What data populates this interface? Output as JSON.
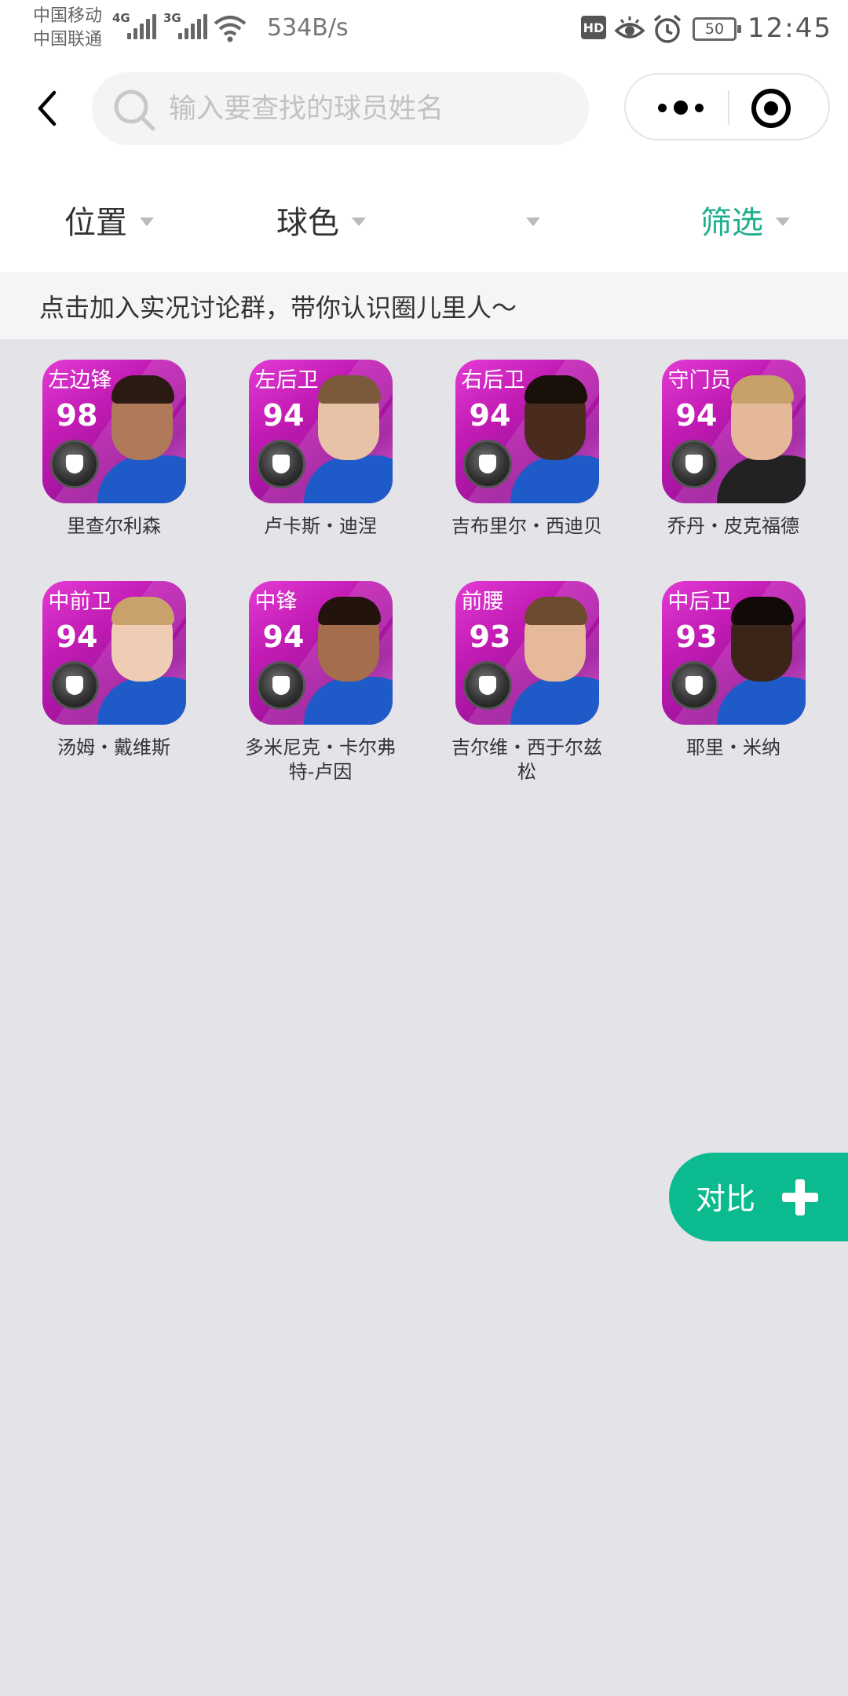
{
  "status_bar": {
    "carrier_1": "中国移动",
    "carrier_2": "中国联通",
    "net_1": "4G",
    "net_2": "3G",
    "speed": "534B/s",
    "hd": "HD",
    "battery": "50",
    "time": "12:45"
  },
  "search": {
    "placeholder": "输入要查找的球员姓名",
    "value": ""
  },
  "filters": [
    {
      "label": "位置",
      "active": false
    },
    {
      "label": "球色",
      "active": false
    },
    {
      "label": "",
      "active": false
    },
    {
      "label": "筛选",
      "active": true
    }
  ],
  "banner": {
    "text": "点击加入实况讨论群，带你认识圈儿里人～"
  },
  "players": [
    {
      "position": "左边锋",
      "rating": "98",
      "name": "里查尔利森",
      "skin": "#b07a5a",
      "hair": "#2a1a12"
    },
    {
      "position": "左后卫",
      "rating": "94",
      "name": "卢卡斯・迪涅",
      "skin": "#e8c2a6",
      "hair": "#7a5a3a"
    },
    {
      "position": "右后卫",
      "rating": "94",
      "name": "吉布里尔・西迪贝",
      "skin": "#4a2c1e",
      "hair": "#1a100a"
    },
    {
      "position": "守门员",
      "rating": "94",
      "name": "乔丹・皮克福德",
      "skin": "#e6b89a",
      "hair": "#c7a16a"
    },
    {
      "position": "中前卫",
      "rating": "94",
      "name": "汤姆・戴维斯",
      "skin": "#efcdb5",
      "hair": "#c9a26b"
    },
    {
      "position": "中锋",
      "rating": "94",
      "name": "多米尼克・卡尔弗特-卢因",
      "skin": "#a46d4c",
      "hair": "#22140c"
    },
    {
      "position": "前腰",
      "rating": "93",
      "name": "吉尔维・西于尔兹松",
      "skin": "#e5b99a",
      "hair": "#6c4b2e"
    },
    {
      "position": "中后卫",
      "rating": "93",
      "name": "耶里・米纳",
      "skin": "#3b2418",
      "hair": "#120a06"
    }
  ],
  "compare": {
    "label": "对比"
  }
}
